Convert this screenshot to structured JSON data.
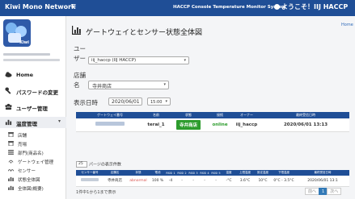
{
  "header": {
    "brand": "Kiwi Mono Network",
    "menu_icon": "hamburger-icon",
    "system_name": "HACCP Console Temperature Monitor System",
    "welcome": "ようこそ！IIJ HACCP"
  },
  "sidebar": {
    "items": [
      {
        "label": "Home",
        "icon": "cloud-icon"
      },
      {
        "label": "パスワードの変更",
        "icon": "key-icon"
      },
      {
        "label": "ユーザー管理",
        "icon": "users-icon"
      },
      {
        "label": "温度管理",
        "icon": "chart-icon"
      }
    ],
    "sub_items": [
      {
        "label": "店舗",
        "icon": "store-icon"
      },
      {
        "label": "売場",
        "icon": "store-icon"
      },
      {
        "label": "部門(商品名)",
        "icon": "list-icon"
      },
      {
        "label": "ゲートウェイ管理",
        "icon": "gateway-icon"
      },
      {
        "label": "センサー",
        "icon": "sensor-icon"
      },
      {
        "label": "状態全体図",
        "icon": "chart-icon"
      },
      {
        "label": "全体図(概要)",
        "icon": "chart-icon"
      }
    ]
  },
  "main": {
    "breadcrumb": "Home",
    "title": "ゲートウェイとセンサー状態全体図",
    "user_label_1": "ユー",
    "user_label_2": "ザー",
    "user_value": "iij_haccp (IIJ HACCP)",
    "store_label_1": "店舗",
    "store_label_2": "名",
    "store_value": "寺井商店",
    "date_label": "表示日時",
    "date_value": "2020/06/01",
    "time_value": "15:00"
  },
  "gateway_table": {
    "headers": [
      "ゲートウェイ番号",
      "名前",
      "状態",
      "接続",
      "オーナー",
      "最終受信日時"
    ],
    "row": {
      "name": "terai_1",
      "status": "寺井商店",
      "connection": "online",
      "owner": "iij_haccp",
      "last_received": "2020/06/01 13:13"
    }
  },
  "page_size": {
    "value": "25",
    "label": "パージの表示件数"
  },
  "sensor_table": {
    "headers": [
      "センサー番号",
      "店舗名",
      "状態",
      "電池",
      "RSSI 1",
      "RSSI 2",
      "RSSI 3",
      "RSSI 4",
      "RSSI 5",
      "温度",
      "上限温度",
      "設定温度",
      "下限温度",
      "最終受信日時"
    ],
    "row": {
      "store": "寺井商店",
      "status": "abnormal",
      "battery": "100 %",
      "rssi1": "-4",
      "rssi2": "-",
      "rssi3": "-",
      "rssi4": "-",
      "rssi5": "-",
      "temp": "-°C",
      "upper": "3.6°C",
      "set": "10°C",
      "lower": "0°C - 3.5°C",
      "last_received": "2020/06/01 13:1"
    }
  },
  "summary": "1件中1から1まで表示",
  "pager": {
    "prev": "前へ",
    "current": "1",
    "next": "次へ"
  },
  "colors": {
    "brand_blue": "#1f4e96",
    "online_green": "#2d9c2d",
    "abnormal_red": "#d9534f"
  }
}
